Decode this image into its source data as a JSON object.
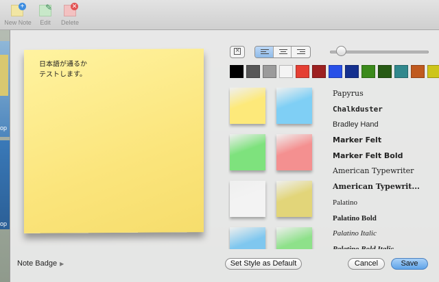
{
  "toolbar": {
    "new_note": "New Note",
    "edit": "Edit",
    "delete": "Delete"
  },
  "background": {
    "partial_label_1": "op",
    "partial_label_2": "op"
  },
  "note": {
    "text": "日本語が通るか\nテストします。",
    "color": "#fbe57c"
  },
  "colors": [
    "#000000",
    "#575757",
    "#9b9b9b",
    "#f4f4f4",
    "#e53f33",
    "#9d2121",
    "#2850e8",
    "#15308f",
    "#3b8a1b",
    "#275a14",
    "#31888d",
    "#c05a1f",
    "#cdc51a"
  ],
  "styles": [
    {
      "name": "yellow",
      "color": "#fde97a"
    },
    {
      "name": "blue",
      "color": "#7fcff5"
    },
    {
      "name": "green",
      "color": "#7ee27d"
    },
    {
      "name": "pink",
      "color": "#f49090"
    },
    {
      "name": "white",
      "color": "#f3f3f3"
    },
    {
      "name": "khaki",
      "color": "#e2d579"
    },
    {
      "name": "sky",
      "color": "#7fc7ef"
    },
    {
      "name": "lime",
      "color": "#8ee18a"
    }
  ],
  "fonts": [
    {
      "label": "Papyrus",
      "family": "\"DejaVu Serif\", serif",
      "weight": "normal",
      "style": "normal"
    },
    {
      "label": "Chalkduster",
      "family": "\"DejaVu Sans Mono\", monospace",
      "weight": "bold",
      "style": "normal"
    },
    {
      "label": "Bradley Hand",
      "family": "\"Liberation Sans\", sans-serif",
      "weight": "normal",
      "style": "normal"
    },
    {
      "label": "Marker Felt",
      "family": "\"DejaVu Sans\", sans-serif",
      "weight": "bold",
      "style": "normal"
    },
    {
      "label": "Marker Felt Bold",
      "family": "\"DejaVu Sans\", sans-serif",
      "weight": "bold",
      "style": "normal"
    },
    {
      "label": "American Typewriter",
      "family": "\"DejaVu Serif\", serif",
      "weight": "normal",
      "style": "normal"
    },
    {
      "label": "American Typewrit...",
      "family": "\"DejaVu Serif\", serif",
      "weight": "bold",
      "style": "normal"
    },
    {
      "label": "Palatino",
      "family": "\"Liberation Serif\", serif",
      "weight": "normal",
      "style": "normal"
    },
    {
      "label": "Palatino Bold",
      "family": "\"Liberation Serif\", serif",
      "weight": "bold",
      "style": "normal"
    },
    {
      "label": "Palatino Italic",
      "family": "\"Liberation Serif\", serif",
      "weight": "normal",
      "style": "italic"
    },
    {
      "label": "Palatino Bold Italic",
      "family": "\"Liberation Serif\", serif",
      "weight": "bold",
      "style": "italic"
    }
  ],
  "footer": {
    "note_badge": "Note Badge",
    "set_default": "Set Style as Default",
    "cancel": "Cancel",
    "save": "Save"
  },
  "size_slider": 0.12
}
